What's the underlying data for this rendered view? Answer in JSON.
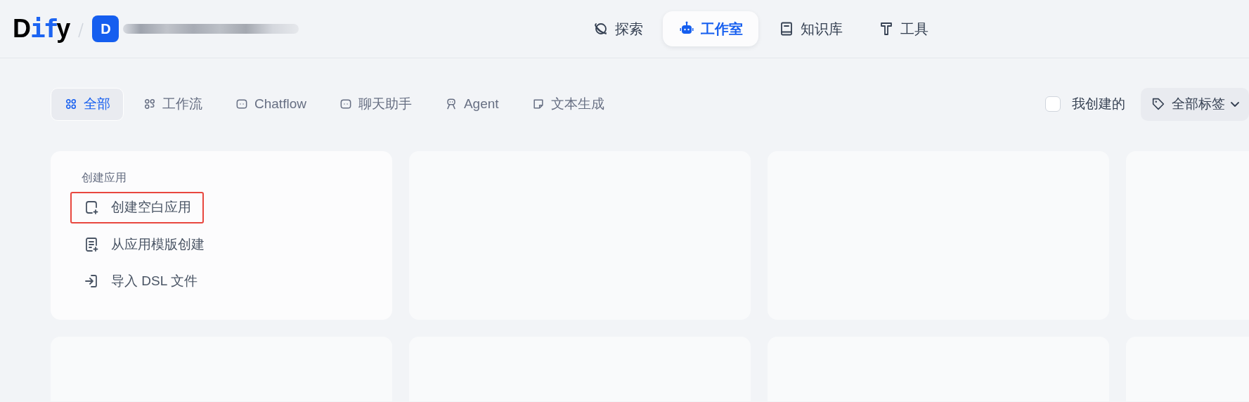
{
  "header": {
    "logo": [
      {
        "text": "D",
        "accent": false
      },
      {
        "text": "if",
        "accent": true
      },
      {
        "text": "y",
        "accent": false
      }
    ],
    "workspace": {
      "initial": "D"
    },
    "nav": [
      {
        "label": "探索",
        "kind": "planet",
        "selected": false
      },
      {
        "label": "工作室",
        "kind": "robot",
        "selected": true
      },
      {
        "label": "知识库",
        "kind": "book",
        "selected": false
      },
      {
        "label": "工具",
        "kind": "hammer",
        "selected": false
      }
    ]
  },
  "filters": {
    "tabs": [
      {
        "label": "全部",
        "kind": "grid",
        "selected": true
      },
      {
        "label": "工作流",
        "kind": "flow",
        "selected": false
      },
      {
        "label": "Chatflow",
        "kind": "chat",
        "selected": false
      },
      {
        "label": "聊天助手",
        "kind": "chat",
        "selected": false
      },
      {
        "label": "Agent",
        "kind": "agent",
        "selected": false
      },
      {
        "label": "文本生成",
        "kind": "note",
        "selected": false
      }
    ],
    "mine": {
      "label": "我创建的",
      "checked": false
    },
    "tags": {
      "label": "全部标签"
    }
  },
  "cards": [
    {
      "kind": "create",
      "title": "创建应用",
      "actions": [
        {
          "label": "创建空白应用",
          "kind": "filePlus",
          "highlighted": true
        },
        {
          "label": "从应用模版创建",
          "kind": "docPlus",
          "highlighted": false
        },
        {
          "label": "导入 DSL 文件",
          "kind": "import",
          "highlighted": false
        }
      ]
    },
    {
      "kind": "empty"
    },
    {
      "kind": "empty"
    },
    {
      "kind": "empty"
    },
    {
      "kind": "empty"
    },
    {
      "kind": "empty"
    },
    {
      "kind": "empty"
    },
    {
      "kind": "empty"
    }
  ]
}
